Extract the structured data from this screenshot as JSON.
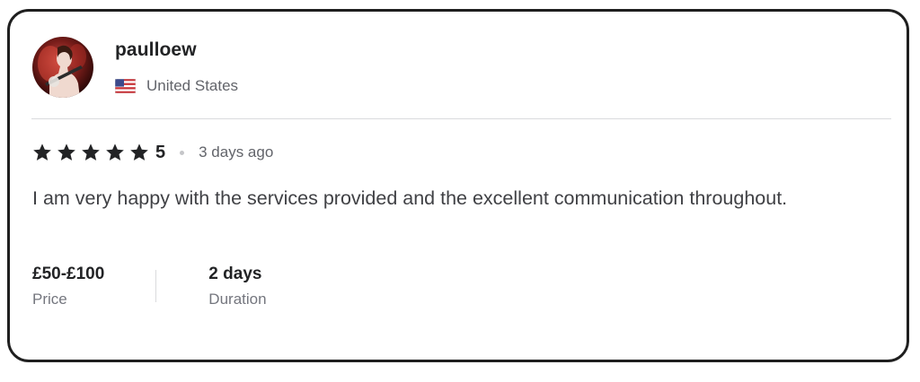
{
  "reviewer": {
    "username": "paulloew",
    "country": "United States",
    "flag_icon": "us-flag-icon"
  },
  "review": {
    "rating": 5,
    "rating_text": "5",
    "time_ago": "3 days ago",
    "text": "I am very happy with the services provided and the excellent communication throughout."
  },
  "details": {
    "price_value": "£50-£100",
    "price_label": "Price",
    "duration_value": "2 days",
    "duration_label": "Duration"
  },
  "colors": {
    "star": "#222325",
    "border": "#1f1f1f",
    "muted_text": "#62646a"
  }
}
